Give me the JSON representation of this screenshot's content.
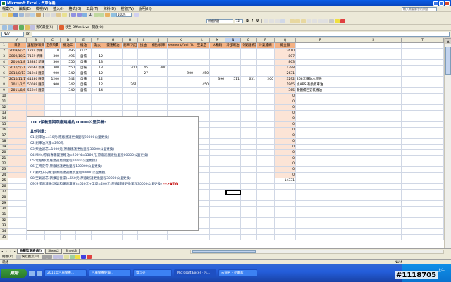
{
  "window": {
    "title": "Microsoft Excel - 汽車保養"
  },
  "menu": {
    "items": [
      "檔案(F)",
      "編輯(E)",
      "檢視(V)",
      "插入(I)",
      "格式(O)",
      "工具(T)",
      "資料(D)",
      "視窗(W)",
      "說明(H)"
    ],
    "help_placeholder": "輸入需要解答的問題"
  },
  "toolbar": {
    "zoom": "100%",
    "font": "新細明體",
    "size": "12",
    "bold": "B",
    "italic": "I",
    "underline": "U",
    "favorites": "我的最愛(S)",
    "web_office": "移至 Office Live",
    "open": "開啟(O)"
  },
  "formula_bar": {
    "name_box": "N27",
    "fx": "fx"
  },
  "columns": [
    "A",
    "B",
    "C",
    "D",
    "E",
    "F",
    "G",
    "H",
    "I",
    "J",
    "K",
    "L",
    "M",
    "N",
    "O",
    "P",
    "Q",
    "R",
    "S",
    "T"
  ],
  "header_row": [
    "日期",
    "里程數/項目",
    "定保項費",
    "機油工",
    "機油",
    "點火",
    "變速箱油",
    "剎車/汽缸",
    "換油",
    "輪胎/刹車",
    "element/fuel filter",
    "空氣芯",
    "水箱精",
    "冷卻劑油",
    "冷凝器清潔",
    "冷氣濾網",
    "總金額"
  ],
  "rows": [
    {
      "n": "2",
      "a": "2009/8/25",
      "b": "1224",
      "b2": "新購",
      "c": "0",
      "d": "495",
      "e": "2115",
      "f": "",
      "g": "",
      "h": "",
      "i": "",
      "j": "",
      "k": "",
      "l": "",
      "m": "",
      "nn": "",
      "o": "",
      "p": "",
      "q": "2610",
      "note": ""
    },
    {
      "n": "3",
      "a": "2009/10/24",
      "b": "7169",
      "b2": "新購",
      "c": "300",
      "d": "495",
      "e": "自備",
      "f": "12",
      "g": "",
      "h": "",
      "i": "",
      "j": "",
      "k": "",
      "l": "",
      "m": "",
      "nn": "",
      "o": "",
      "p": "",
      "q": "807",
      "note": ""
    },
    {
      "n": "4",
      "a": "2010/1/8",
      "b": "13883",
      "b2": "新購",
      "c": "300",
      "d": "550",
      "e": "自備",
      "f": "13",
      "g": "",
      "h": "",
      "i": "",
      "j": "",
      "k": "",
      "l": "",
      "m": "",
      "nn": "",
      "o": "",
      "p": "",
      "q": "863",
      "note": ""
    },
    {
      "n": "5",
      "a": "2010/5/21",
      "b": "23664",
      "b2": "新購",
      "c": "300",
      "d": "550",
      "e": "自備",
      "f": "13",
      "g": "",
      "h": "200",
      "i": "45",
      "j": "400",
      "k": "",
      "l": "",
      "m": "",
      "nn": "",
      "o": "",
      "p": "",
      "q": "1798",
      "note": ""
    },
    {
      "n": "6",
      "a": "2010/8/13",
      "b": "31948",
      "b2": "隆晟",
      "c": "900",
      "d": "342",
      "e": "自備",
      "f": "12",
      "g": "",
      "h": "",
      "i": "27",
      "j": "",
      "k": "900",
      "l": "450",
      "m": "",
      "nn": "",
      "o": "",
      "p": "",
      "q": "2631",
      "note": ""
    },
    {
      "n": "7",
      "a": "2010/11/17",
      "b": "41480",
      "b2": "隆晟",
      "c": "1200",
      "d": "342",
      "e": "自備",
      "f": "12",
      "g": "",
      "h": "",
      "i": "",
      "j": "",
      "k": "",
      "l": "",
      "m": "396",
      "nn": "511",
      "o": "631",
      "p": "200",
      "q": "3292",
      "note": "268元購防水膠條"
    },
    {
      "n": "8",
      "a": "2011/2/5",
      "b": "50089",
      "b2": "隆晟",
      "c": "900",
      "d": "342",
      "e": "自備",
      "f": "12",
      "g": "",
      "h": "261",
      "i": "",
      "j": "",
      "k": "",
      "l": "450",
      "m": "",
      "nn": "",
      "o": "",
      "p": "",
      "q": "1965",
      "note": "換ABS 有換煞車油"
    },
    {
      "n": "9",
      "a": "2011/8/6",
      "b": "55949",
      "b2": "隆晟",
      "c": "",
      "d": "342",
      "e": "自備",
      "f": "14",
      "g": "",
      "h": "",
      "i": "",
      "j": "",
      "k": "",
      "l": "",
      "m": "",
      "nn": "",
      "o": "",
      "p": "",
      "q": "365",
      "note": "軟體備回安裝機油"
    }
  ],
  "empty_totals": [
    "0",
    "0",
    "0",
    "0",
    "0",
    "0",
    "0",
    "0",
    "0",
    "0",
    "0",
    "0",
    "0",
    "0",
    "0"
  ],
  "grand_total": "14331",
  "row_numbers": [
    "1",
    "2",
    "3",
    "4",
    "5",
    "6",
    "7",
    "8",
    "9",
    "10",
    "11",
    "12",
    "13",
    "14",
    "15",
    "16",
    "17",
    "18",
    "19",
    "20",
    "21",
    "22",
    "23",
    "24",
    "25",
    "26",
    "27",
    "28",
    "29",
    "30",
    "31",
    "32",
    "33",
    "34",
    "35"
  ],
  "notebox": {
    "title": "TDCi保養週期跟廠建議約10000公里保養!",
    "subtitle": "其他列舉：",
    "lines": [
      "01.剎車油=410元(原廠建議更換里程20000公里更換)",
      "02.剎車油汽閥=290元",
      "03.柴油濾芯=1000元(原廠建議更換里程30000公里更換)",
      "04.MH4/原廠專屬變速箱油=200*4=1560元(原廠建議更換里程60000公里更換)",
      "05.電瓶類(原廠建議更換里程10000公里更換)",
      "06.正時皮帶(原廠建議更換里程100000公里更換)",
      "07.動力方向機油(原廠建議更換里程40000公里更換)",
      "08.空氣濾芯(新擴送養碟)=650元(原廠建議更換里程30000公里更換)",
      "09.冷卻過濾器(冷氣和暖過濾器)=650元+工資=200元(原廠建議更換里程30000公里更換)"
    ],
    "new_tag": "--->NEW"
  },
  "sheets": {
    "tabs": [
      "胎壓監測表(記)",
      "Sheet2",
      "Sheet3"
    ],
    "active": 0
  },
  "drawing": {
    "label": "繪圖(R)",
    "autoshape": "快取圖案(U)"
  },
  "status": {
    "left": "就緒",
    "right": "NUM"
  },
  "taskbar": {
    "start": "開始",
    "items": [
      "2011年汽車保養...",
      "汽車保養紀錄...",
      "資料夾",
      "Microsoft Excel - 汽...",
      "未命名 - 小畫家"
    ],
    "active": 3,
    "clock": "上午"
  },
  "watermark": "#1118705"
}
